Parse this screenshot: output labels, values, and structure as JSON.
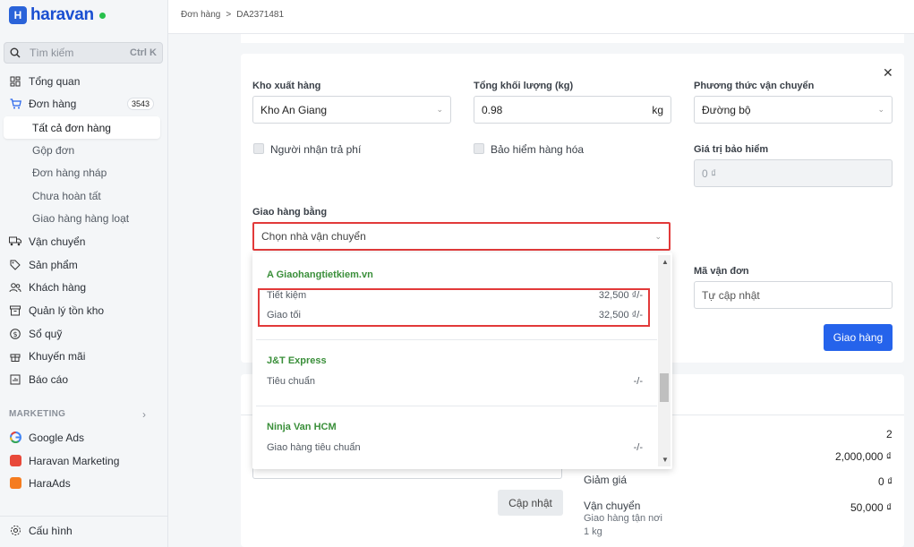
{
  "brand": {
    "name": "haravan",
    "mark": "H"
  },
  "search": {
    "placeholder": "Tìm kiếm",
    "shortcut": "Ctrl K"
  },
  "sidebar": {
    "items": [
      {
        "label": "Tổng quan",
        "icon": "dashboard-icon"
      },
      {
        "label": "Đơn hàng",
        "icon": "cart-icon",
        "badge": "3543"
      },
      {
        "label": "Vận chuyển",
        "icon": "truck-icon"
      },
      {
        "label": "Sản phẩm",
        "icon": "tag-icon"
      },
      {
        "label": "Khách hàng",
        "icon": "users-icon"
      },
      {
        "label": "Quản lý tồn kho",
        "icon": "inventory-icon"
      },
      {
        "label": "Sổ quỹ",
        "icon": "dollar-icon"
      },
      {
        "label": "Khuyến mãi",
        "icon": "gift-icon"
      },
      {
        "label": "Báo cáo",
        "icon": "report-icon"
      }
    ],
    "orders_sub": [
      "Tất cả đơn hàng",
      "Gộp đơn",
      "Đơn hàng nháp",
      "Chưa hoàn tất",
      "Giao hàng hàng loạt"
    ],
    "marketing_title": "MARKETING",
    "marketing_apps": [
      "Google Ads",
      "Haravan Marketing",
      "HaraAds"
    ],
    "settings_label": "Cấu hình"
  },
  "breadcrumb": {
    "parent": "Đơn hàng",
    "sep": ">",
    "current": "DA2371481"
  },
  "form": {
    "warehouse_label": "Kho xuất hàng",
    "warehouse_value": "Kho An Giang",
    "weight_label": "Tổng khối lượng (kg)",
    "weight_value": "0.98",
    "weight_unit": "kg",
    "method_label": "Phương thức vận chuyển",
    "method_value": "Đường bộ",
    "receiver_pays_label": "Người nhận trả phí",
    "insurance_label": "Bảo hiểm hàng hóa",
    "insurance_value_label": "Giá trị bảo hiểm",
    "insurance_value_placeholder": "0 ₫",
    "carrier_label": "Giao hàng bằng",
    "carrier_placeholder": "Chọn nhà vận chuyển",
    "tracking_label": "Mã vận đơn",
    "tracking_placeholder": "Tự cập nhật",
    "submit_label": "Giao hàng"
  },
  "carriers": [
    {
      "name": "A Giaohangtietkiem.vn",
      "options": [
        {
          "name": "Tiết kiệm",
          "price": "32,500 ₫/-"
        },
        {
          "name": "Giao tối",
          "price": "32,500 ₫/-"
        }
      ]
    },
    {
      "name": "J&T Express",
      "options": [
        {
          "name": "Tiêu chuẩn",
          "price": "-/-"
        }
      ]
    },
    {
      "name": "Ninja Van HCM",
      "options": [
        {
          "name": "Giao hàng tiêu chuẩn",
          "price": "-/-"
        }
      ]
    }
  ],
  "summary": {
    "qty": "2",
    "subtotal": "2,000,000 ₫",
    "discount_label": "Giảm giá",
    "discount": "0 ₫",
    "shipping_label": "Vận chuyển",
    "shipping_sub1": "Giao hàng tận nơi",
    "shipping_sub2": "1 kg",
    "shipping": "50,000 ₫",
    "update_label": "Cập nhật"
  },
  "colors": {
    "accent": "#2563eb",
    "highlight": "#e23a3a",
    "carrier_green": "#3a8f3a"
  }
}
